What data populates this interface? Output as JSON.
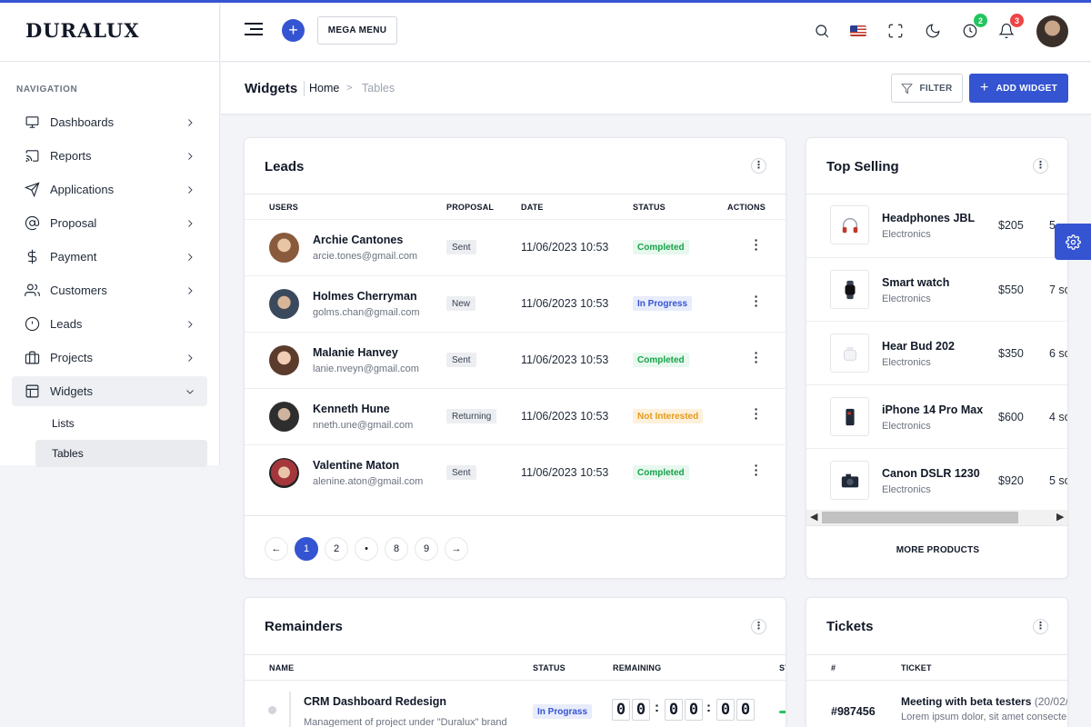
{
  "app": {
    "logo": "DURALUX"
  },
  "sidebar": {
    "caption": "NAVIGATION",
    "items": [
      {
        "label": "Dashboards",
        "icon": "monitor-icon"
      },
      {
        "label": "Reports",
        "icon": "cast-icon"
      },
      {
        "label": "Applications",
        "icon": "send-icon"
      },
      {
        "label": "Proposal",
        "icon": "at-sign-icon"
      },
      {
        "label": "Payment",
        "icon": "dollar-icon"
      },
      {
        "label": "Customers",
        "icon": "users-icon"
      },
      {
        "label": "Leads",
        "icon": "alert-circle-icon"
      },
      {
        "label": "Projects",
        "icon": "briefcase-icon"
      },
      {
        "label": "Widgets",
        "icon": "layout-icon"
      }
    ],
    "sub_items": [
      {
        "label": "Lists"
      },
      {
        "label": "Tables"
      }
    ]
  },
  "header": {
    "mega_menu": "MEGA MENU",
    "plus": "+",
    "timer_badge": "2",
    "notif_badge": "3"
  },
  "page": {
    "title": "Widgets",
    "breadcrumb_home": "Home",
    "breadcrumb_sep": ">",
    "breadcrumb_current": "Tables",
    "filter_label": "FILTER",
    "add_label": "ADD WIDGET",
    "add_plus": "+"
  },
  "leads": {
    "title": "Leads",
    "headers": {
      "users": "USERS",
      "proposal": "PROPOSAL",
      "date": "DATE",
      "status": "STATUS",
      "actions": "ACTIONS"
    },
    "rows": [
      {
        "name": "Archie Cantones",
        "email": "arcie.tones@gmail.com",
        "proposal": "Sent",
        "date": "11/06/2023 10:53",
        "status": "Completed"
      },
      {
        "name": "Holmes Cherryman",
        "email": "golms.chan@gmail.com",
        "proposal": "New",
        "date": "11/06/2023 10:53",
        "status": "In Progress"
      },
      {
        "name": "Malanie Hanvey",
        "email": "lanie.nveyn@gmail.com",
        "proposal": "Sent",
        "date": "11/06/2023 10:53",
        "status": "Completed"
      },
      {
        "name": "Kenneth Hune",
        "email": "nneth.une@gmail.com",
        "proposal": "Returning",
        "date": "11/06/2023 10:53",
        "status": "Not Interested"
      },
      {
        "name": "Valentine Maton",
        "email": "alenine.aton@gmail.com",
        "proposal": "Sent",
        "date": "11/06/2023 10:53",
        "status": "Completed"
      }
    ],
    "pagination": {
      "prev": "←",
      "pages": [
        "1",
        "2",
        "•",
        "8",
        "9"
      ],
      "next": "→",
      "active": "1"
    }
  },
  "top_selling": {
    "title": "Top Selling",
    "products": [
      {
        "name": "Headphones JBL",
        "category": "Electronics",
        "price": "$205",
        "sold": "5",
        "icon": "headphones-icon"
      },
      {
        "name": "Smart watch",
        "category": "Electronics",
        "price": "$550",
        "sold": "7 so",
        "icon": "smartwatch-icon"
      },
      {
        "name": "Hear Bud 202",
        "category": "Electronics",
        "price": "$350",
        "sold": "6 so",
        "icon": "earbuds-icon"
      },
      {
        "name": "iPhone 14 Pro Max",
        "category": "Electronics",
        "price": "$600",
        "sold": "4 so",
        "icon": "phone-icon"
      },
      {
        "name": "Canon DSLR 1230",
        "category": "Electronics",
        "price": "$920",
        "sold": "5 so",
        "icon": "camera-icon"
      }
    ],
    "more": "MORE PRODUCTS"
  },
  "remainders": {
    "title": "Remainders",
    "headers": {
      "name": "NAME",
      "status": "STATUS",
      "remaining": "REMAINING",
      "st": "ST"
    },
    "rows": [
      {
        "name": "CRM Dashboard Redesign",
        "desc": "Management of project under \"Duralux\" brand",
        "status": "In Prograss",
        "timer": [
          "0",
          "0",
          "0",
          "0",
          "0",
          "0"
        ]
      }
    ]
  },
  "tickets": {
    "title": "Tickets",
    "headers": {
      "num": "#",
      "ticket": "TICKET"
    },
    "rows": [
      {
        "id": "#987456",
        "title": "Meeting with beta testers",
        "date": "(20/02/",
        "desc": "Lorem ipsum dolor, sit amet consecte"
      }
    ]
  },
  "colors": {
    "primary": "#3454d1",
    "success": "#17a34a",
    "warning": "#e59a1a"
  }
}
